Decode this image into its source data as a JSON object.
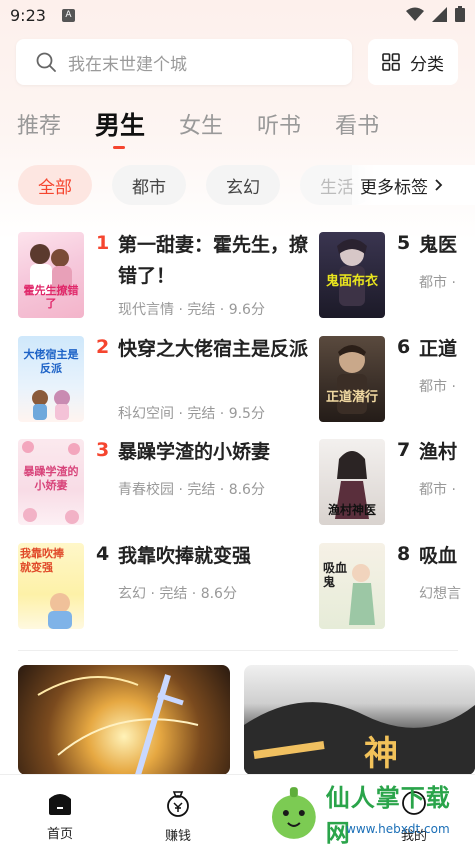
{
  "status_bar": {
    "time": "9:23",
    "notification_badge": "A"
  },
  "search": {
    "placeholder": "我在末世建个城"
  },
  "category_button": {
    "label": "分类"
  },
  "tabs": [
    {
      "label": "推荐",
      "active": false
    },
    {
      "label": "男生",
      "active": true
    },
    {
      "label": "女生",
      "active": false
    },
    {
      "label": "听书",
      "active": false
    },
    {
      "label": "看书",
      "active": false
    }
  ],
  "chips": [
    {
      "label": "全部",
      "active": true
    },
    {
      "label": "都市",
      "active": false
    },
    {
      "label": "玄幻",
      "active": false
    },
    {
      "label": "生活",
      "active": false
    }
  ],
  "more_tags": {
    "label": "更多标签",
    "icon": "chevron-right-icon"
  },
  "books_left": [
    {
      "rank": "1",
      "title": "第一甜妻：霍先生，撩错了！",
      "meta": "现代言情 · 完结 · 9.6分",
      "cover_text": "霍先生撩错了"
    },
    {
      "rank": "2",
      "title": "快穿之大佬宿主是反派",
      "meta": "科幻空间 · 完结 · 9.5分",
      "cover_text": "大佬宿主是反派"
    },
    {
      "rank": "3",
      "title": "暴躁学渣的小娇妻",
      "meta": "青春校园 · 完结 · 8.6分",
      "cover_text": "暴躁学渣的小娇妻"
    },
    {
      "rank": "4",
      "title": "我靠吹捧就变强",
      "meta": "玄幻 · 完结 · 8.6分",
      "cover_text": "我靠吹捧就变强"
    }
  ],
  "books_right": [
    {
      "rank": "5",
      "title": "鬼医",
      "meta": "都市 ·",
      "cover_text": "鬼面布衣"
    },
    {
      "rank": "6",
      "title": "正道",
      "meta": "都市 ·",
      "cover_text": "正道潜行"
    },
    {
      "rank": "7",
      "title": "渔村",
      "meta": "都市 ·",
      "cover_text": "渔村神医"
    },
    {
      "rank": "8",
      "title": "吸血",
      "meta": "幻想言",
      "cover_text": "吸血鬼"
    }
  ],
  "banners": [
    {
      "name": "sword-banner"
    },
    {
      "name": "ink-banner",
      "overlay_text": "神"
    }
  ],
  "bottom_nav": [
    {
      "label": "首页",
      "icon": "home-icon",
      "active": true
    },
    {
      "label": "赚钱",
      "icon": "money-bag-icon",
      "active": false
    },
    {
      "label": "我的",
      "icon": "profile-icon",
      "active": false
    }
  ],
  "watermark": {
    "text": "仙人掌下载网",
    "url": "www.hebxdt.com"
  },
  "colors": {
    "accent": "#f5452f",
    "muted": "#999999"
  }
}
